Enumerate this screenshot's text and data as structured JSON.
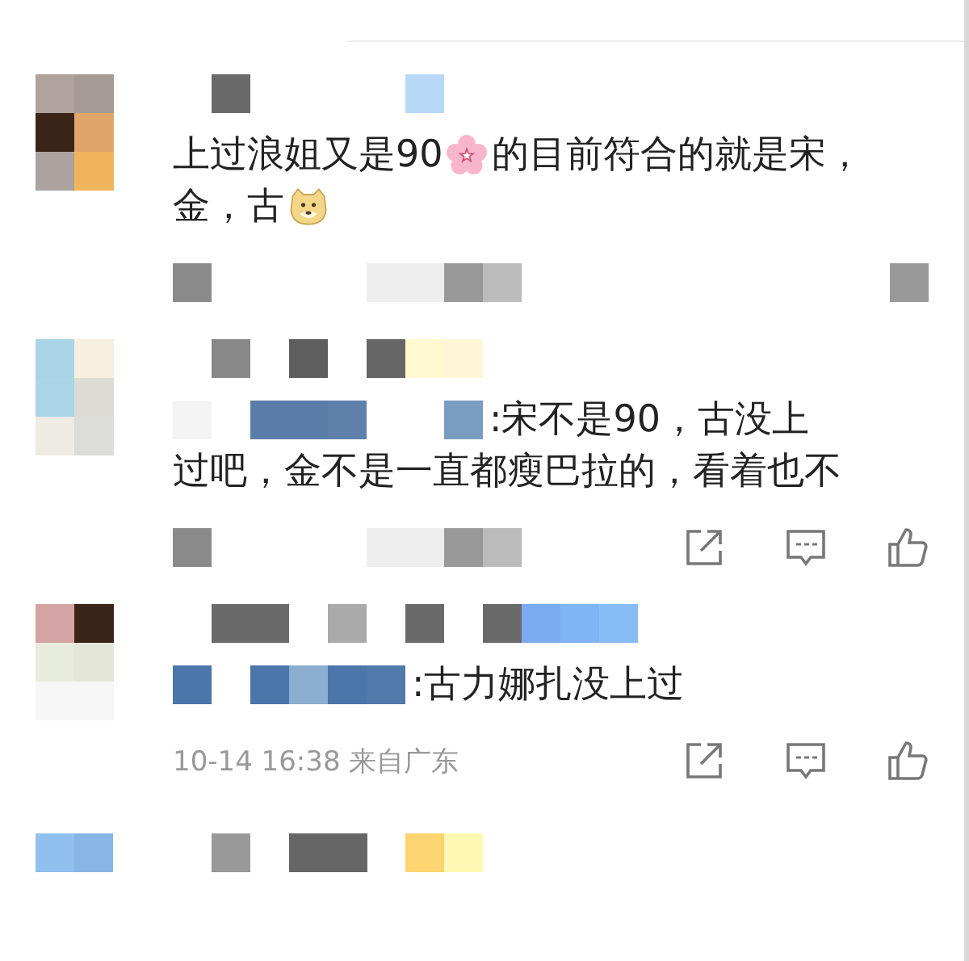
{
  "comments": [
    {
      "lines": [
        [
          {
            "kind": "text",
            "text": "上过浪姐又是90"
          },
          {
            "kind": "flower"
          },
          {
            "kind": "text",
            "text": "的目前符合的就是宋，"
          }
        ],
        [
          {
            "kind": "text",
            "text": "金，古"
          },
          {
            "kind": "dog"
          }
        ]
      ],
      "actions": false
    },
    {
      "lines": [
        [
          {
            "kind": "mosaic"
          },
          {
            "kind": "text",
            "text": ":宋不是90，古没上"
          }
        ],
        [
          {
            "kind": "text",
            "text": "过吧，金不是一直都瘦巴拉的，看着也不"
          }
        ]
      ],
      "actions": true
    },
    {
      "lines": [
        [
          {
            "kind": "mosaic"
          },
          {
            "kind": "text",
            "text": ":古力娜扎没上过"
          }
        ]
      ],
      "time": "10-14 16:38 来自广东",
      "actions": true
    }
  ]
}
